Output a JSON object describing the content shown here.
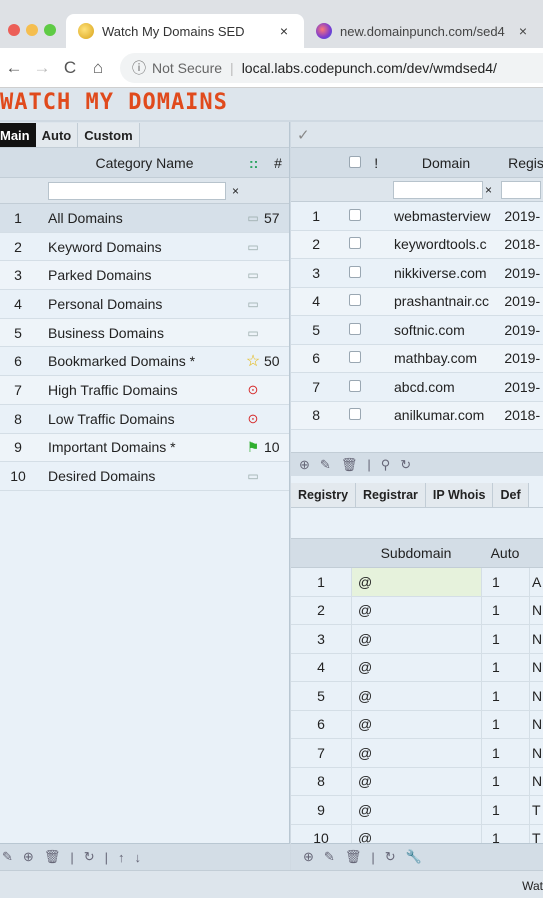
{
  "browser": {
    "tabs": [
      {
        "title": "Watch My Domains SED",
        "active": true,
        "icon": "app-favicon"
      },
      {
        "title": "new.domainpunch.com/sed4",
        "active": false,
        "icon": "site-favicon"
      }
    ],
    "close_glyph": "×",
    "security_label": "Not Secure",
    "url": "local.labs.codepunch.com/dev/wmdsed4/"
  },
  "app": {
    "logo": "WATCH MY DOMAINS",
    "accent": "#e04a1c"
  },
  "left_panel": {
    "tabs": [
      "Main",
      "Auto",
      "Custom"
    ],
    "header": {
      "name": "Category Name",
      "dots": "::",
      "count": "#"
    },
    "filter_clear": "×",
    "categories": [
      {
        "num": "1",
        "name": "All Domains",
        "icon": "folder-icon",
        "count": "57"
      },
      {
        "num": "2",
        "name": "Keyword Domains",
        "icon": "folder-icon",
        "count": ""
      },
      {
        "num": "3",
        "name": "Parked Domains",
        "icon": "folder-icon",
        "count": ""
      },
      {
        "num": "4",
        "name": "Personal Domains",
        "icon": "folder-icon",
        "count": ""
      },
      {
        "num": "5",
        "name": "Business Domains",
        "icon": "folder-icon",
        "count": ""
      },
      {
        "num": "6",
        "name": "Bookmarked Domains *",
        "icon": "star-icon",
        "count": "50"
      },
      {
        "num": "7",
        "name": "High Traffic Domains",
        "icon": "target-icon",
        "count": ""
      },
      {
        "num": "8",
        "name": "Low Traffic Domains",
        "icon": "target-icon",
        "count": ""
      },
      {
        "num": "9",
        "name": "Important Domains *",
        "icon": "flag-icon",
        "count": "10"
      },
      {
        "num": "10",
        "name": "Desired Domains",
        "icon": "folder-icon",
        "count": ""
      }
    ]
  },
  "domain_grid": {
    "header": {
      "excl": "!",
      "domain": "Domain",
      "registry": "Regist"
    },
    "filter_clear": "×",
    "rows": [
      {
        "num": "1",
        "domain": "webmasterview",
        "registry": "2019-"
      },
      {
        "num": "2",
        "domain": "keywordtools.c",
        "registry": "2018-"
      },
      {
        "num": "3",
        "domain": "nikkiverse.com",
        "registry": "2019-"
      },
      {
        "num": "4",
        "domain": "prashantnair.cc",
        "registry": "2019-"
      },
      {
        "num": "5",
        "domain": "softnic.com",
        "registry": "2019-"
      },
      {
        "num": "6",
        "domain": "mathbay.com",
        "registry": "2019-"
      },
      {
        "num": "7",
        "domain": "abcd.com",
        "registry": "2019-"
      },
      {
        "num": "8",
        "domain": "anilkumar.com",
        "registry": "2018-"
      }
    ]
  },
  "detail_tabs": [
    "Registry",
    "Registrar",
    "IP Whois",
    "Def"
  ],
  "subdomain_grid": {
    "header": {
      "subdomain": "Subdomain",
      "auto": "Auto"
    },
    "rows": [
      {
        "num": "1",
        "subdomain": "@",
        "auto": "1",
        "extra": "A"
      },
      {
        "num": "2",
        "subdomain": "@",
        "auto": "1",
        "extra": "N"
      },
      {
        "num": "3",
        "subdomain": "@",
        "auto": "1",
        "extra": "N"
      },
      {
        "num": "4",
        "subdomain": "@",
        "auto": "1",
        "extra": "N"
      },
      {
        "num": "5",
        "subdomain": "@",
        "auto": "1",
        "extra": "N"
      },
      {
        "num": "6",
        "subdomain": "@",
        "auto": "1",
        "extra": "N"
      },
      {
        "num": "7",
        "subdomain": "@",
        "auto": "1",
        "extra": "N"
      },
      {
        "num": "8",
        "subdomain": "@",
        "auto": "1",
        "extra": "N"
      },
      {
        "num": "9",
        "subdomain": "@",
        "auto": "1",
        "extra": "T"
      },
      {
        "num": "10",
        "subdomain": "@",
        "auto": "1",
        "extra": "T"
      }
    ]
  },
  "status": {
    "text": "Wat"
  }
}
